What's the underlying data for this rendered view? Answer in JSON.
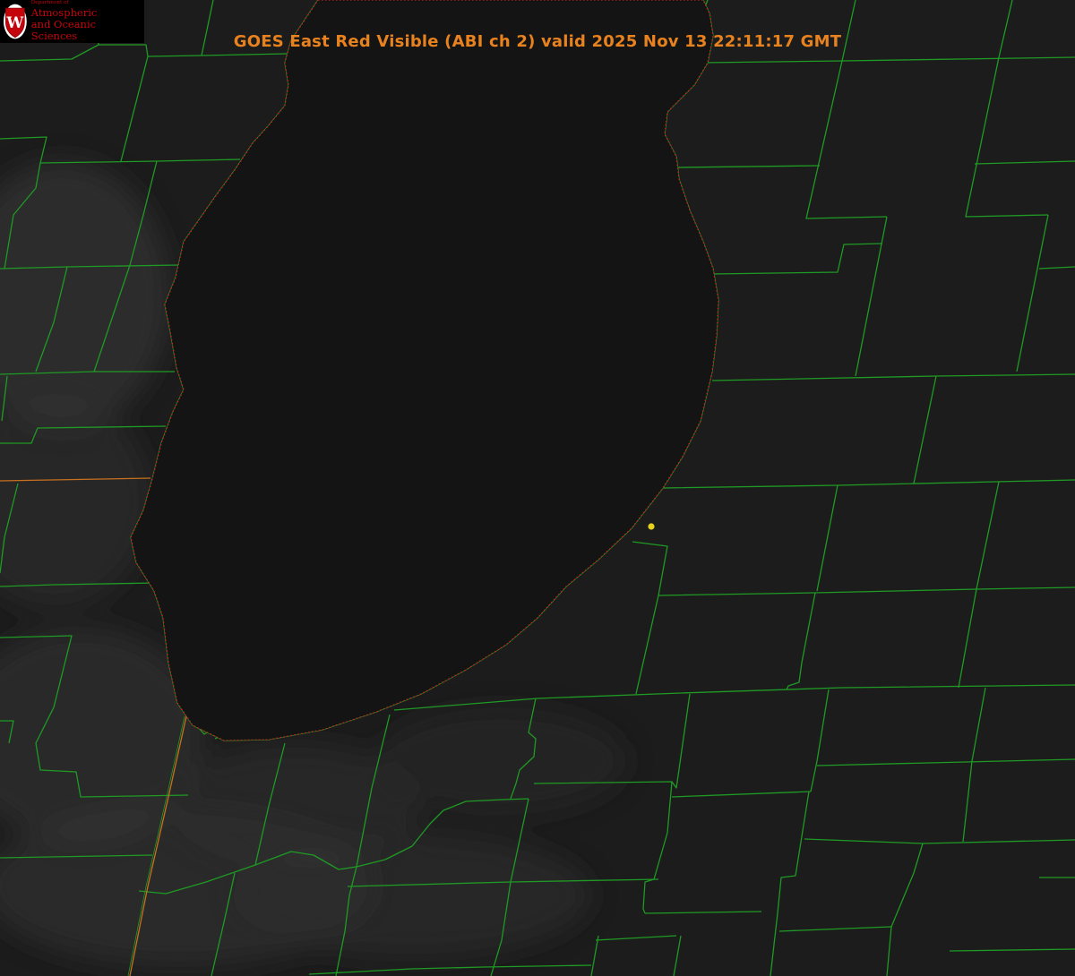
{
  "title": "GOES East Red Visible (ABI ch 2) valid 2025 Nov 13 22:11:17 GMT",
  "logo": {
    "department_line": "Department of",
    "name_line1": "Atmospheric",
    "name_line2": "and Oceanic Sciences",
    "shield_letter": "W",
    "color": "#c5050c"
  },
  "colors": {
    "title": "#e8821e",
    "county_lines": "#1f9a24",
    "coastline_dotted": "#d42020",
    "state_line": "#c8701e",
    "station_marker": "#e6d21e",
    "lake_surface": "#141414",
    "land_surface": "#1c1c1c"
  },
  "map": {
    "product": "GOES East Red Visible (ABI ch 2)",
    "features": [
      "lake-michigan-southern-basin",
      "county-boundaries",
      "state-boundary",
      "coastline",
      "station-marker"
    ]
  }
}
